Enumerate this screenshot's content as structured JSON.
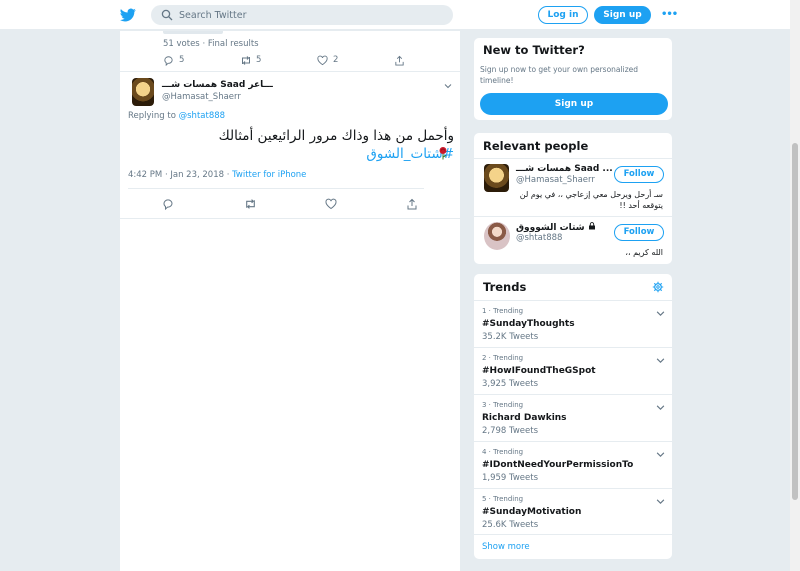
{
  "header": {
    "search_placeholder": "Search Twitter",
    "login_label": "Log in",
    "signup_label": "Sign up",
    "more_label": "•••"
  },
  "poll": {
    "meta": "51 votes · Final results",
    "replies": "5",
    "retweets": "5",
    "likes": "2"
  },
  "tweet": {
    "author_name": "همسات شـــ Saad ـــاعر",
    "author_handle": "@Hamasat_Shaerr",
    "replying_prefix": "Replying to ",
    "replying_to": "@shtat888",
    "text": "وأحمل من هذا وذاك مرور الرائيعين أمثالك ",
    "hashtag": "#شتات_الشوق",
    "timestamp": "4:42 PM · Jan 23, 2018 · ",
    "source": "Twitter for iPhone"
  },
  "new_to_twitter": {
    "title": "New to Twitter?",
    "subtitle": "Sign up now to get your own personalized timeline!",
    "button": "Sign up"
  },
  "relevant_people": {
    "title": "Relevant people",
    "people": [
      {
        "name": "همسات شـــ Saad ...",
        "handle": "@Hamasat_Shaerr",
        "follow": "Follow",
        "bio": "سـ أرحل ويرحل معي إزعاجي ،، في يوم لن يتوقعه أحد !!"
      },
      {
        "name": "شتات الشوووق",
        "handle": "@shtat888",
        "follow": "Follow",
        "bio": "الله كريم ،،"
      }
    ]
  },
  "trends": {
    "title": "Trends",
    "items": [
      {
        "rank": "1 · Trending",
        "name": "#SundayThoughts",
        "count": "35.2K Tweets"
      },
      {
        "rank": "2 · Trending",
        "name": "#HowIFoundTheGSpot",
        "count": "3,925 Tweets"
      },
      {
        "rank": "3 · Trending",
        "name": "Richard Dawkins",
        "count": "2,798 Tweets"
      },
      {
        "rank": "4 · Trending",
        "name": "#IDontNeedYourPermissionTo",
        "count": "1,959 Tweets"
      },
      {
        "rank": "5 · Trending",
        "name": "#SundayMotivation",
        "count": "25.6K Tweets"
      }
    ],
    "show_more": "Show more"
  },
  "colors": {
    "accent": "#1da1f2",
    "background": "#e6ecf0",
    "secondary_text": "#657786"
  }
}
